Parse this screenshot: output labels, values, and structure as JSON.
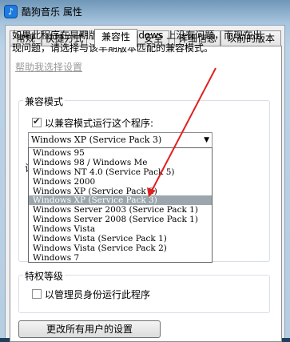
{
  "window": {
    "title": "酷狗音乐 属性",
    "icon": "app-icon"
  },
  "tabs": [
    "常规",
    "快捷方式",
    "兼容性",
    "安全",
    "详细信息",
    "以前的版本"
  ],
  "active_tab": "兼容性",
  "intro": {
    "line1": "如果此程序在早期版本的 Windows 上没有问题，而现在出",
    "line2": "现问题，请选择与该早期版本匹配的兼容模式。"
  },
  "help_link": "帮助我选择设置",
  "compat": {
    "group_title": "兼容模式",
    "checkbox_label": "以兼容模式运行这个程序:",
    "checkbox_checked": true,
    "selected": "Windows XP (Service Pack 3)",
    "options": [
      "Windows 95",
      "Windows 98 / Windows Me",
      "Windows NT 4.0 (Service Pack 5)",
      "Windows 2000",
      "Windows XP (Service Pack 2)",
      "Windows XP (Service Pack 3)",
      "Windows Server 2003 (Service Pack 1)",
      "Windows Server 2008 (Service Pack 1)",
      "Windows Vista",
      "Windows Vista (Service Pack 1)",
      "Windows Vista (Service Pack 2)",
      "Windows 7"
    ],
    "highlighted_index": 5
  },
  "settings_group_partial": "设",
  "privilege": {
    "group_title": "特权等级",
    "checkbox_label": "以管理员身份运行此程序",
    "checkbox_checked": false
  },
  "all_users_button": "更改所有用户的设置",
  "annotation_color": "#e02020"
}
